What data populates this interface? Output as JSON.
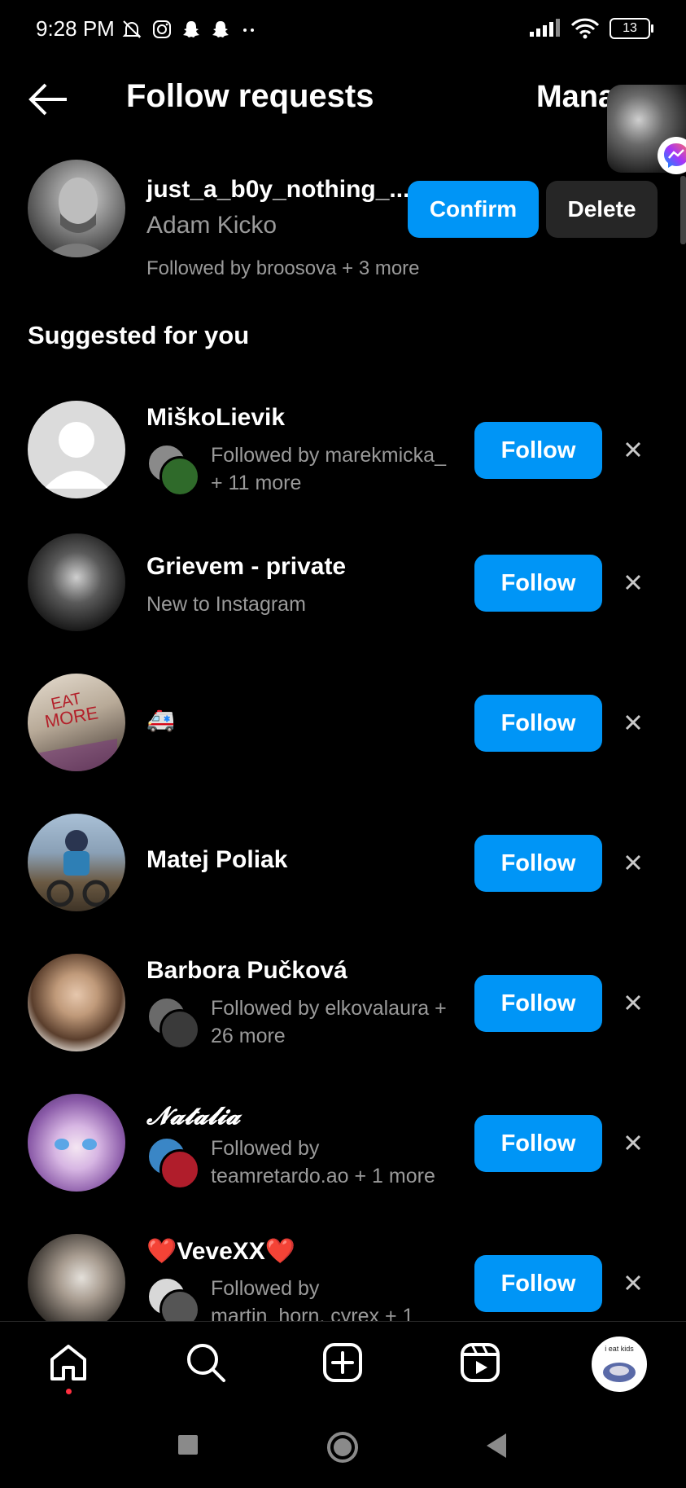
{
  "status_bar": {
    "time": "9:28 PM",
    "battery": "13"
  },
  "header": {
    "title": "Follow requests",
    "manage_label": "Mana"
  },
  "request": {
    "username": "just_a_b0y_nothing_...",
    "full_name": "Adam Kicko",
    "followed_by": "Followed by broosova + 3 more",
    "confirm_label": "Confirm",
    "delete_label": "Delete"
  },
  "section_title": "Suggested for you",
  "follow_label": "Follow",
  "suggestions": [
    {
      "name": "MiškoLievik",
      "sub_line1": "Followed by marekmicka_",
      "sub_line2": "+ 11 more"
    },
    {
      "name": "Grievem - private",
      "sub_line1": "New to Instagram",
      "sub_line2": ""
    },
    {
      "name": "🚑",
      "sub_line1": "",
      "sub_line2": ""
    },
    {
      "name": "Matej Poliak",
      "sub_line1": "",
      "sub_line2": ""
    },
    {
      "name": "Barbora Pučková",
      "sub_line1": "Followed by elkovalaura +",
      "sub_line2": "26 more"
    },
    {
      "name": "𝓝𝓪𝓽𝓪𝓵𝓲𝓪",
      "sub_line1": "Followed by",
      "sub_line2": "teamretardo.ao + 1 more"
    },
    {
      "name": "❤️VeveXX❤️",
      "sub_line1": "Followed by",
      "sub_line2": "martin_horn, cyrex + 1"
    }
  ],
  "nav": {
    "profile_text": "i eat kids"
  },
  "colors": {
    "accent": "#0095f6",
    "background": "#000000",
    "secondary_text": "#9a9a9a",
    "delete_bg": "#262626",
    "notification_dot": "#ff3040"
  }
}
